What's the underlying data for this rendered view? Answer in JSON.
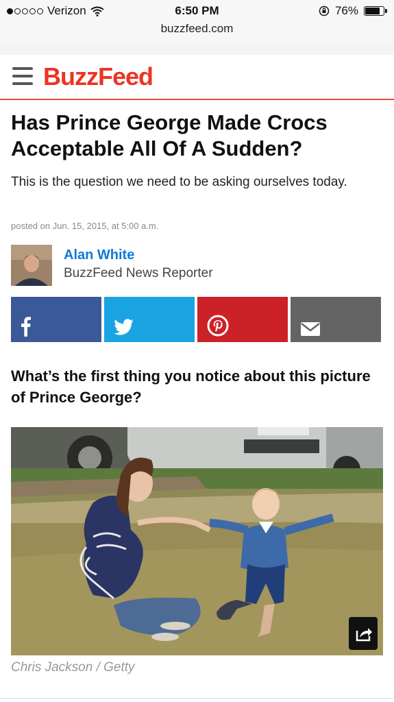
{
  "status_bar": {
    "carrier": "Verizon",
    "time": "6:50 PM",
    "battery": "76%",
    "battery_level": 0.76,
    "signal_bars": 1
  },
  "browser": {
    "url": "buzzfeed.com"
  },
  "header": {
    "logo": "BuzzFeed"
  },
  "article": {
    "title": "Has Prince George Made Crocs Acceptable All Of A Sudden?",
    "subtitle": "This is the question we need to be asking ourselves today.",
    "posted": "posted on Jun. 15, 2015, at 5:00 a.m.",
    "author": {
      "name": "Alan White",
      "role": "BuzzFeed News Reporter"
    },
    "share_buttons": [
      {
        "name": "facebook",
        "icon": "facebook-icon",
        "color": "#3b5998"
      },
      {
        "name": "twitter",
        "icon": "twitter-icon",
        "color": "#1aa3e3"
      },
      {
        "name": "pinterest",
        "icon": "pinterest-icon",
        "color": "#cc2127"
      },
      {
        "name": "email",
        "icon": "email-icon",
        "color": "#646464"
      }
    ],
    "question": "What’s the first thing you notice about this picture of Prince George?",
    "photo_credit": "Chris Jackson / Getty"
  },
  "colors": {
    "brand_red": "#ee3322",
    "author_link": "#0f79d6"
  }
}
